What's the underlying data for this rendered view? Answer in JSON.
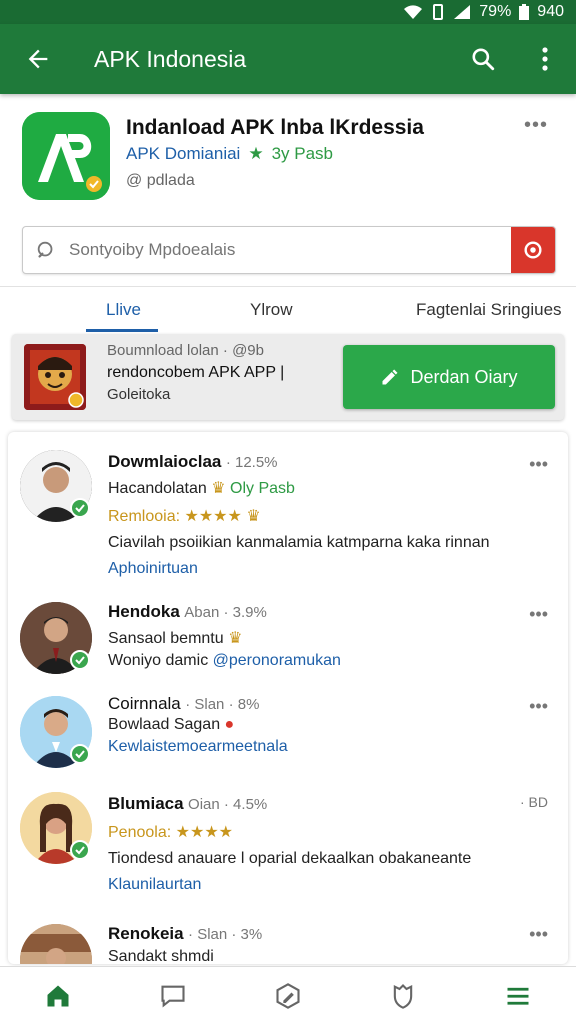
{
  "status_bar": {
    "battery": "79%",
    "time": "940"
  },
  "app_bar": {
    "title": "APK Indonesia"
  },
  "app_header": {
    "name": "Indanload APK lnba lKrdessia",
    "developer": "APK Domianiai",
    "tag": "3y Pasb",
    "package": "@ pdlada"
  },
  "search": {
    "placeholder": "Sontyoiby Mpdoealais"
  },
  "tabs": [
    {
      "label": "Llive",
      "active": true
    },
    {
      "label": "Ylrow",
      "active": false
    },
    {
      "label": "Fagtenlai Sringiues",
      "active": false
    }
  ],
  "banner": {
    "line1": "Boumnload lolan · @9b",
    "line2": "rendoncobem APK APP |",
    "line3": "Goleitoka",
    "button_label": "Derdan Oiary"
  },
  "feed": [
    {
      "name": "Dowmlaioclaa",
      "meta": "· 12.5%",
      "line2": "Hacandolatan",
      "line2_green": "Oly Pasb",
      "line3": "Remlooia:",
      "stars": "★★★★",
      "body": "Ciavilah  psoiikian kanmalamia katmparna kaka rinnan",
      "link": "Aphoinirtuan"
    },
    {
      "name": "Hendoka",
      "meta": "Aban · 3.9%",
      "line2": "Sansaol bemntu",
      "line3_dark": "Woniyo damic",
      "line3_blue": "@peronoramukan"
    },
    {
      "name": "Coirnnala",
      "meta": "· Slan · 8%",
      "line2": "Bowlaad Sagan",
      "line3": "Kewlaistemoearmeetnala"
    },
    {
      "name": "Blumiaca",
      "meta": "Oian · 4.5%",
      "line2": "Penoola:",
      "stars": "★★★★",
      "body": "Tiondesd anauare l oparial dekaalkan obakaneante",
      "link": "Klaunilaurtan",
      "right": "· BD"
    },
    {
      "name": "Renokeia",
      "meta": "· Slan · 3%",
      "line2": "Sandakt shmdi"
    }
  ],
  "colors": {
    "primary": "#1f7a3a",
    "status_bar": "#1a6b33",
    "accent_blue": "#1e5fa8",
    "button_green": "#2ba84a",
    "search_red": "#d9362b",
    "star_gold": "#c8961d"
  },
  "icons": {
    "back": "arrow-left-icon",
    "search": "search-icon",
    "menu": "more-vert-icon",
    "bottom_nav": [
      "home-icon",
      "chat-icon",
      "edit-icon",
      "shield-icon",
      "menu-icon"
    ]
  }
}
